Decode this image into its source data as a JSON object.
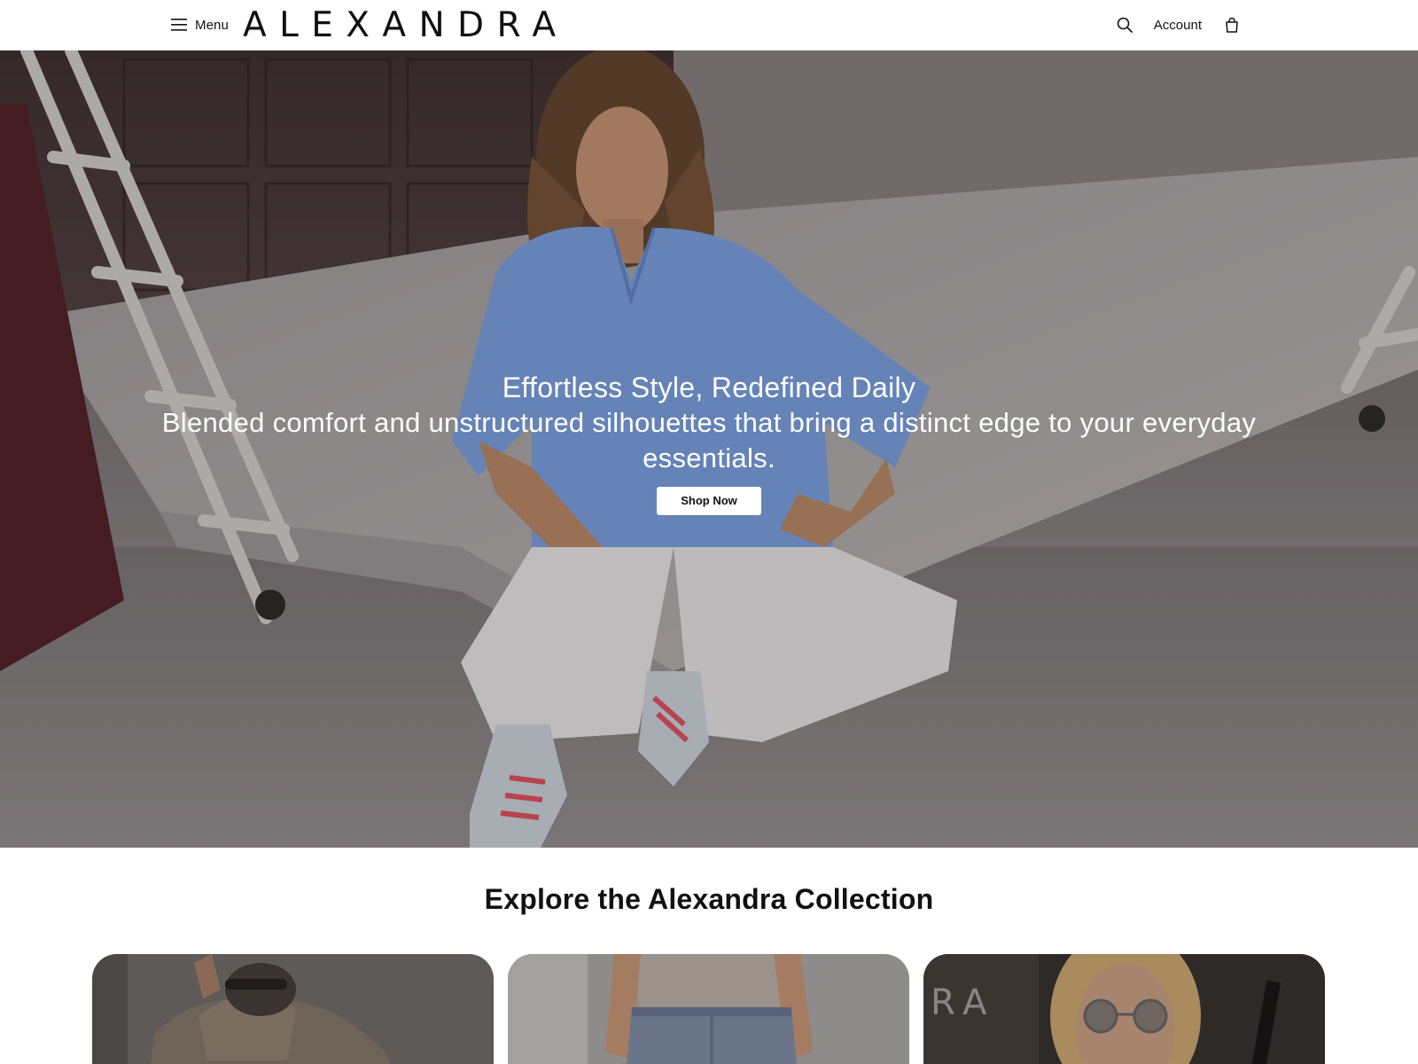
{
  "header": {
    "menu_label": "Menu",
    "brand": "ALEXANDRA",
    "account_label": "Account",
    "icons": [
      "menu-icon",
      "search-icon",
      "shopping-bag-icon"
    ]
  },
  "hero": {
    "title": "Effortless Style, Redefined Daily",
    "subtitle": "Blended comfort and unstructured silhouettes that bring a distinct edge to your everyday essentials.",
    "cta_label": "Shop Now"
  },
  "collection": {
    "title": "Explore the Alexandra Collection",
    "cards": [
      {
        "image": "outerwear-model"
      },
      {
        "image": "denim-model",
        "alt": "Denim"
      },
      {
        "image": "sunglasses-model",
        "alt": "Accessories",
        "overlay_text": "RA"
      }
    ]
  }
}
